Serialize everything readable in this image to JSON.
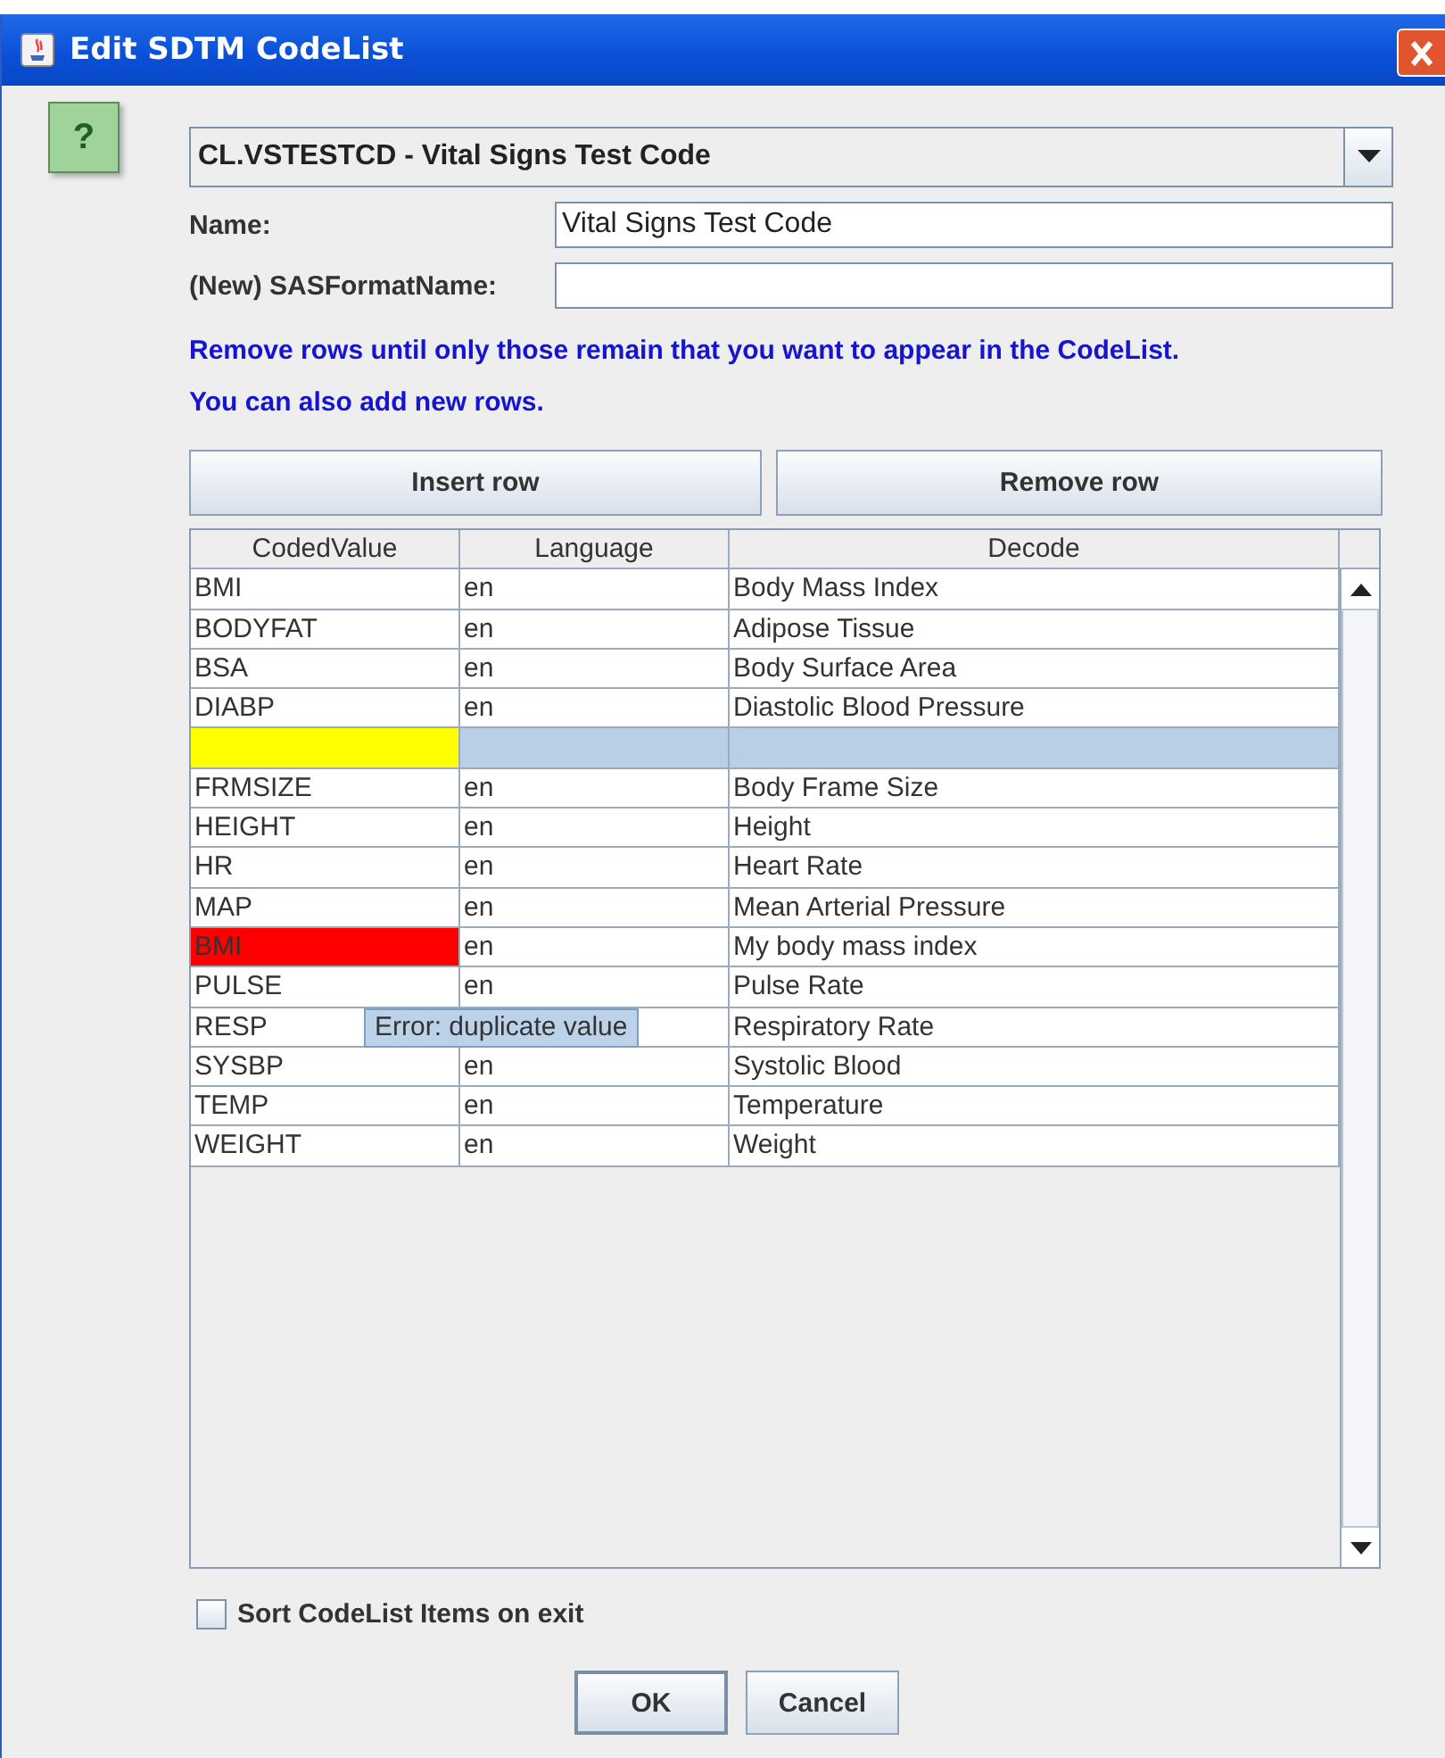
{
  "window": {
    "title": "Edit SDTM CodeList"
  },
  "help_button": {
    "label": "?"
  },
  "codelist_combo": {
    "value": "CL.VSTESTCD - Vital Signs Test Code"
  },
  "fields": [
    {
      "label": "Name:",
      "value": "Vital Signs Test Code"
    },
    {
      "label": "(New) SASFormatName:"
    }
  ],
  "instructions": [
    "Remove rows until only those remain that you want to appear in the CodeList.",
    "You can also add new rows."
  ],
  "buttons": [
    "Insert row",
    "Remove row"
  ],
  "table": {
    "columns": [
      "CodedValue",
      "Language",
      "Decode"
    ],
    "rows": [
      {
        "coded_value": "BMI",
        "language": "en",
        "decode": "Body Mass Index",
        "is_new": false,
        "invalid": false,
        "selected": false
      },
      {
        "coded_value": "BODYFAT",
        "language": "en",
        "decode": "Adipose Tissue",
        "is_new": false,
        "invalid": false,
        "selected": false
      },
      {
        "coded_value": "BSA",
        "language": "en",
        "decode": "Body Surface Area",
        "is_new": false,
        "invalid": false,
        "selected": false
      },
      {
        "coded_value": "DIABP",
        "language": "en",
        "decode": "Diastolic Blood Pressure",
        "is_new": false,
        "invalid": false,
        "selected": false
      },
      {
        "is_new": true,
        "invalid": false,
        "selected": true
      },
      {
        "coded_value": "FRMSIZE",
        "language": "en",
        "decode": "Body Frame Size",
        "is_new": false,
        "invalid": false,
        "selected": false
      },
      {
        "coded_value": "HEIGHT",
        "language": "en",
        "decode": "Height",
        "is_new": false,
        "invalid": false,
        "selected": false
      },
      {
        "coded_value": "HR",
        "language": "en",
        "decode": "Heart Rate",
        "is_new": false,
        "invalid": false,
        "selected": false
      },
      {
        "coded_value": "MAP",
        "language": "en",
        "decode": "Mean Arterial Pressure",
        "is_new": false,
        "invalid": false,
        "selected": false
      },
      {
        "coded_value": "BMI",
        "language": "en",
        "decode": "My body mass index",
        "is_new": false,
        "invalid": true,
        "selected": false
      },
      {
        "coded_value": "PULSE",
        "language": "en",
        "decode": "Pulse Rate",
        "is_new": false,
        "invalid": false,
        "selected": false
      },
      {
        "coded_value": "RESP",
        "decode": "Respiratory Rate",
        "is_new": false,
        "invalid": false,
        "selected": false
      },
      {
        "coded_value": "SYSBP",
        "language": "en",
        "decode": "Systolic Blood",
        "is_new": false,
        "invalid": false,
        "selected": false
      },
      {
        "coded_value": "TEMP",
        "language": "en",
        "decode": "Temperature",
        "is_new": false,
        "invalid": false,
        "selected": false
      },
      {
        "coded_value": "WEIGHT",
        "language": "en",
        "decode": "Weight",
        "is_new": false,
        "invalid": false,
        "selected": false
      }
    ],
    "tooltip": {
      "text": "Error: duplicate value"
    }
  },
  "sort_checkbox": {
    "label": "Sort CodeList Items on exit",
    "checked": false
  },
  "dialog_buttons": [
    "OK",
    "Cancel"
  ]
}
